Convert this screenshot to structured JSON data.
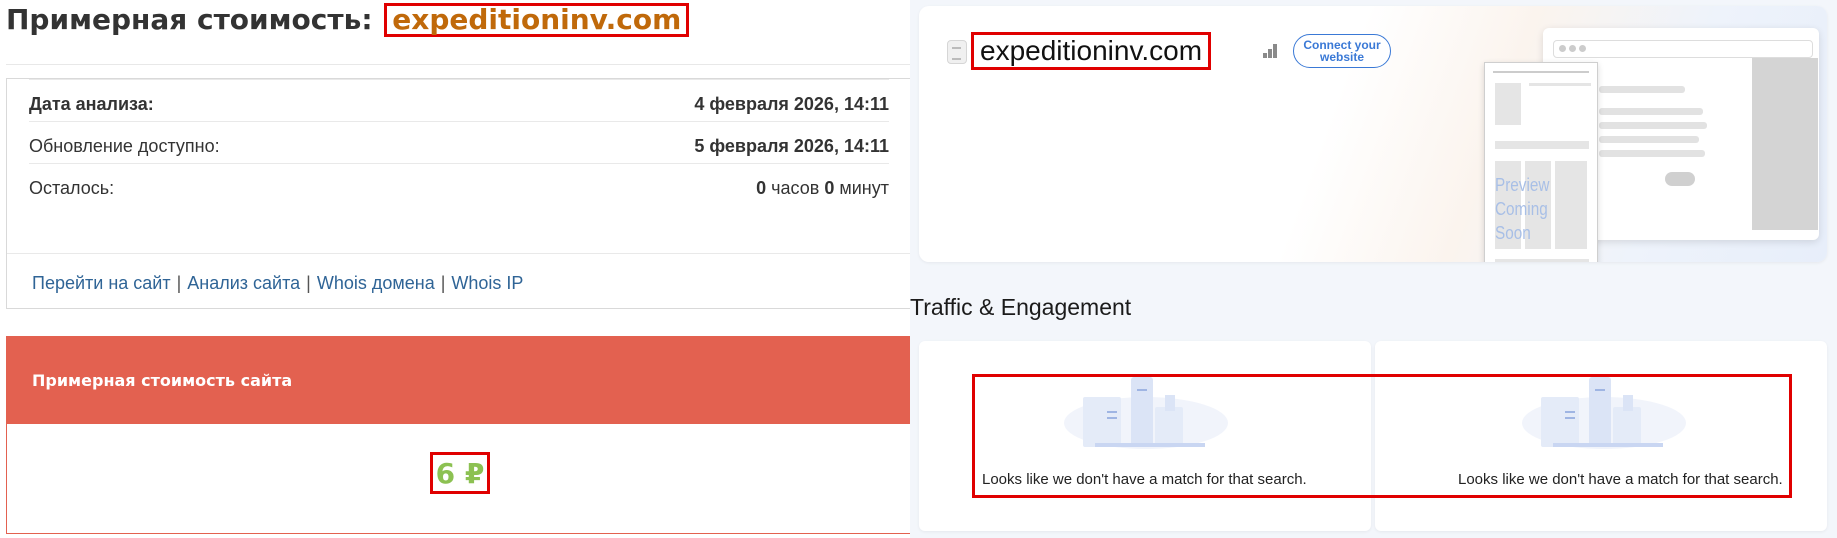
{
  "left": {
    "title_prefix": "Примерная стоимость:",
    "domain": "expeditioninv.com",
    "info": {
      "analysis_date_label": "Дата анализа:",
      "analysis_date_value": "4 февраля 2026, 14:11",
      "update_label": "Обновление доступно:",
      "update_value": "5 февраля 2026, 14:11",
      "remaining_label": "Осталось:",
      "remaining_hours": "0",
      "remaining_hours_unit": "часов",
      "remaining_minutes": "0",
      "remaining_minutes_unit": "минут"
    },
    "links": {
      "goto_site": "Перейти на сайт",
      "site_analysis": "Анализ сайта",
      "whois_domain": "Whois домена",
      "whois_ip": "Whois IP",
      "separator": "|"
    },
    "cost": {
      "header": "Примерная стоимость сайта",
      "value": "6 ₽"
    }
  },
  "right": {
    "domain": "expeditioninv.com",
    "connect_button": "Connect your website",
    "preview_text": "Preview Coming Soon",
    "traffic_title": "Traffic & Engagement",
    "cards": [
      {
        "message": "Looks like we don't have a match for that search."
      },
      {
        "message": "Looks like we don't have a match for that search."
      }
    ]
  },
  "colors": {
    "domain_highlight": "#c0690a",
    "cost_header_bg": "#e36150",
    "cost_value": "#8cc152",
    "link": "#2f6496",
    "highlight_border": "#e00000",
    "connect_accent": "#3a79d6"
  },
  "icons": [
    "file-icon",
    "rank-bars-icon",
    "empty-state-illustration"
  ]
}
